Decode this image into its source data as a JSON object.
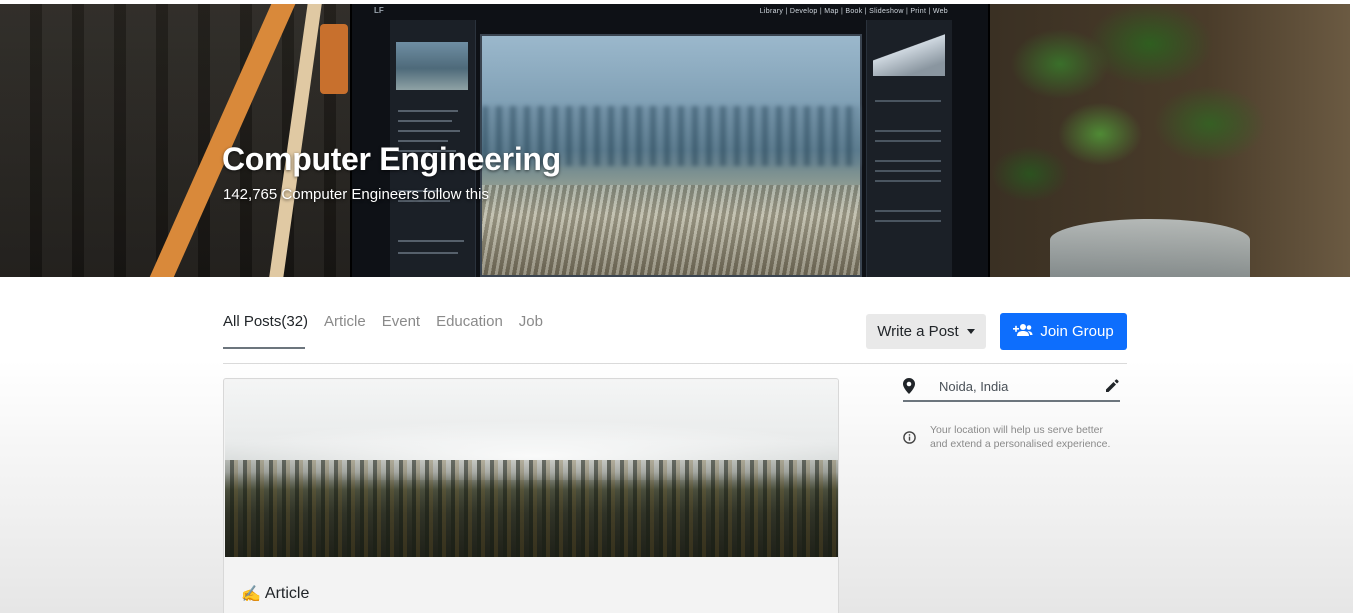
{
  "hero": {
    "title": "Computer Engineering",
    "subtitle": "142,765 Computer Engineers follow this",
    "monitor_menu": "Library | Develop | Map | Book | Slideshow | Print | Web"
  },
  "tabs": [
    {
      "label": "All Posts(32)",
      "active": true
    },
    {
      "label": "Article",
      "active": false
    },
    {
      "label": "Event",
      "active": false
    },
    {
      "label": "Education",
      "active": false
    },
    {
      "label": "Job",
      "active": false
    }
  ],
  "actions": {
    "write_post_label": "Write a Post",
    "join_group_label": "Join Group"
  },
  "post": {
    "type_icon": "✍️",
    "type_label": "Article"
  },
  "location": {
    "value": "Noida, India",
    "help_text": "Your location will help us serve better and extend a personalised experience."
  },
  "colors": {
    "primary": "#0d6efd",
    "secondary_button": "#e9e9e9",
    "muted_text": "#8a8a8a"
  },
  "icons": {
    "join": "add-group-icon",
    "location": "map-pin-icon",
    "edit": "pencil-icon",
    "info": "info-circle-icon",
    "dropdown": "caret-down-icon"
  }
}
